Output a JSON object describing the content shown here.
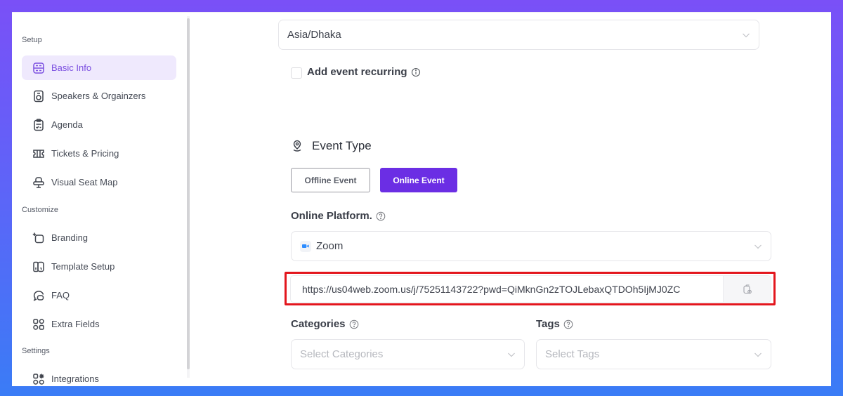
{
  "sidebar": {
    "sections": [
      {
        "label": "Setup",
        "items": [
          {
            "label": "Basic Info",
            "icon": "basic-info-icon",
            "active": true
          },
          {
            "label": "Speakers & Orgainzers",
            "icon": "speaker-icon"
          },
          {
            "label": "Agenda",
            "icon": "agenda-icon"
          },
          {
            "label": "Tickets & Pricing",
            "icon": "ticket-icon"
          },
          {
            "label": "Visual Seat Map",
            "icon": "seat-icon"
          }
        ]
      },
      {
        "label": "Customize",
        "items": [
          {
            "label": "Branding",
            "icon": "branding-icon"
          },
          {
            "label": "Template Setup",
            "icon": "template-icon"
          },
          {
            "label": "FAQ",
            "icon": "faq-icon"
          },
          {
            "label": "Extra Fields",
            "icon": "extra-fields-icon"
          }
        ]
      },
      {
        "label": "Settings",
        "items": [
          {
            "label": "Integrations",
            "icon": "integrations-icon"
          }
        ]
      }
    ]
  },
  "main": {
    "timezone": {
      "value": "Asia/Dhaka"
    },
    "recurring": {
      "label": "Add event recurring",
      "checked": false
    },
    "event_type": {
      "title": "Event Type",
      "options": [
        {
          "label": "Offline Event",
          "selected": false
        },
        {
          "label": "Online Event",
          "selected": true
        }
      ]
    },
    "online_platform": {
      "label": "Online Platform.",
      "value": "Zoom",
      "brand_color": "#2d8cff"
    },
    "meeting_url": {
      "value": "https://us04web.zoom.us/j/75251143722?pwd=QiMknGn2zTOJLebaxQTDOh5IjMJ0ZC",
      "highlight_color": "#e3161d"
    },
    "categories": {
      "label": "Categories",
      "placeholder": "Select Categories"
    },
    "tags": {
      "label": "Tags",
      "placeholder": "Select Tags"
    }
  },
  "colors": {
    "accent": "#6b2ee4",
    "active_nav_bg": "#efe9fd",
    "active_nav_text": "#7b4fe0"
  }
}
